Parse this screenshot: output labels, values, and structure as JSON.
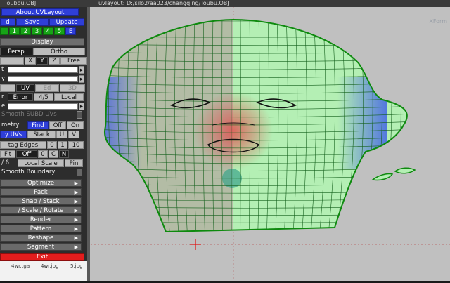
{
  "window": {
    "left_title": "Toubou.OBJ",
    "title": "uvlayout: D:/silo2/aa023/changqing/Toubu.OBJ",
    "view_label": "XForm"
  },
  "panel": {
    "about": "About UVLayout",
    "load": "d",
    "save": "Save",
    "update": "Update",
    "slots": [
      "1",
      "2",
      "3",
      "4",
      "5",
      "E"
    ],
    "display": "Display",
    "persp": "Persp",
    "ortho": "Ortho",
    "axis_label": "",
    "axes": [
      "X",
      "Y",
      "Z",
      "Free"
    ],
    "row_a_label": "t",
    "row_b_label": "y",
    "uv_mode": [
      "UV",
      "Ed",
      "3D"
    ],
    "error_label": "r",
    "error": "Error",
    "ratio": "4/5",
    "local": "Local",
    "row_e_label": "e",
    "smooth_subd": "Smooth SUBD UVs",
    "symmetry": "metry",
    "find": "Find",
    "off": "Off",
    "on": "On",
    "uvs": "y UVs",
    "stack": "Stack",
    "u": "U",
    "v": "V",
    "edges": "tag Edges",
    "n0": "0",
    "n1": "1",
    "n10": "10",
    "fit": "Fit",
    "off2": "Off",
    "zero": "0",
    "c": "C",
    "n": "N",
    "frac": "/ 6",
    "local_scale": "Local Scale",
    "pin": "Pin",
    "smooth_boundary": "Smooth Boundary",
    "menus": [
      "Optimize",
      "Pack",
      "Snap / Stack",
      "/ Scale / Rotate",
      "Render",
      "Pattern",
      "Reshape",
      "Segment"
    ],
    "exit": "Exit"
  },
  "thumbs": [
    "4wr.tga",
    "4wr.jpg",
    "5.jpg"
  ],
  "colors": {
    "mesh": "#0f8a0f",
    "mesh_fill_left": "#b7c7a0",
    "mesh_fill_right": "#b6f0b6",
    "cursor": "#e01010",
    "background": "#c0c0c0"
  }
}
